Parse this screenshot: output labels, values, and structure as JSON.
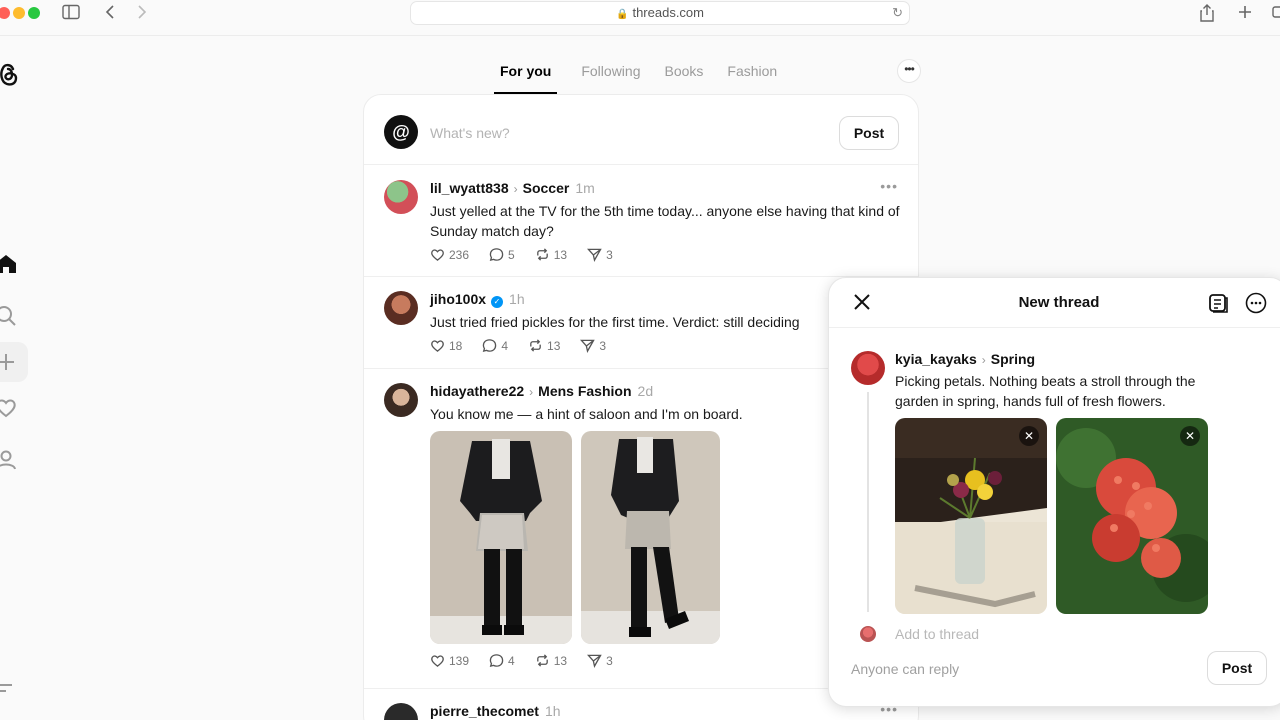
{
  "browser": {
    "url": "threads.com"
  },
  "tabs": [
    {
      "label": "For you"
    },
    {
      "label": "Following"
    },
    {
      "label": "Books"
    },
    {
      "label": "Fashion"
    }
  ],
  "composer": {
    "placeholder": "What's new?",
    "post_label": "Post"
  },
  "posts": [
    {
      "user": "lil_wyatt838",
      "topic": "Soccer",
      "time": "1m",
      "text": "Just yelled at the TV for the 5th time today... anyone else having that kind of Sunday match day?",
      "likes": "236",
      "replies": "5",
      "reposts": "13",
      "shares": "3"
    },
    {
      "user": "jiho100x",
      "verified": true,
      "time": "1h",
      "text": "Just tried fried pickles for the first time. Verdict: still deciding",
      "likes": "18",
      "replies": "4",
      "reposts": "13",
      "shares": "3"
    },
    {
      "user": "hidayathere22",
      "topic": "Mens Fashion",
      "time": "2d",
      "text": "You know me — a hint of saloon and I'm on board.",
      "likes": "139",
      "replies": "4",
      "reposts": "13",
      "shares": "3"
    },
    {
      "user": "pierre_thecomet",
      "time": "1h"
    }
  ],
  "modal": {
    "title": "New thread",
    "user": "kyia_kayaks",
    "topic": "Spring",
    "text": "Picking petals. Nothing beats a stroll through the garden in spring, hands full of fresh flowers.",
    "add_placeholder": "Add to thread",
    "reply_setting": "Anyone can reply",
    "post_label": "Post"
  },
  "colors": {
    "accent_verified": "#0095f6",
    "active_tab": "#000000",
    "muted_text": "#9b9b9b"
  }
}
